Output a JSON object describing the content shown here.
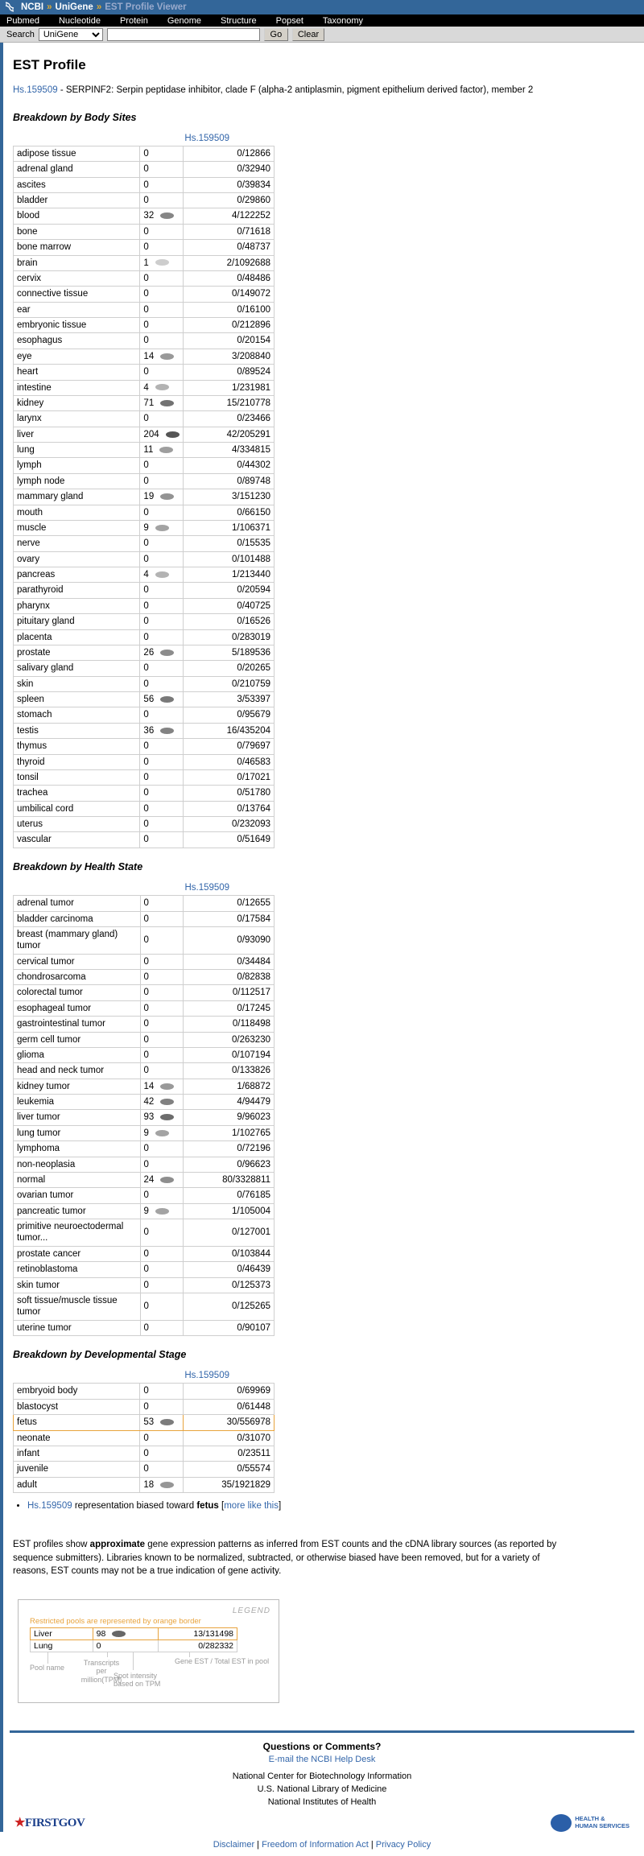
{
  "topbar": {
    "logo_icon": "ncbi-dna-logo",
    "crumb1": "NCBI",
    "sep": "»",
    "crumb2": "UniGene",
    "crumb3": "EST Profile Viewer"
  },
  "nav": {
    "items": [
      {
        "label": "Pubmed"
      },
      {
        "label": "Nucleotide"
      },
      {
        "label": "Protein"
      },
      {
        "label": "Genome"
      },
      {
        "label": "Structure"
      },
      {
        "label": "Popset"
      },
      {
        "label": "Taxonomy"
      }
    ]
  },
  "search": {
    "label": "Search",
    "database": "UniGene",
    "options": [
      "UniGene"
    ],
    "query": "",
    "placeholder": "",
    "go_label": "Go",
    "clear_label": "Clear"
  },
  "page": {
    "title": "EST Profile",
    "gene_id": "Hs.159509",
    "gene_desc": " - SERPINF2: Serpin peptidase inhibitor, clade F (alpha-2 antiplasmin, pigment epithelium derived factor), member 2"
  },
  "sections": [
    {
      "heading": "Breakdown by Body Sites",
      "column_header": "Hs.159509",
      "rows": [
        {
          "name": "adipose tissue",
          "tpm": "0",
          "frac": "0/12866",
          "dot": 0.0
        },
        {
          "name": "adrenal gland",
          "tpm": "0",
          "frac": "0/32940",
          "dot": 0.0
        },
        {
          "name": "ascites",
          "tpm": "0",
          "frac": "0/39834",
          "dot": 0.0
        },
        {
          "name": "bladder",
          "tpm": "0",
          "frac": "0/29860",
          "dot": 0.0
        },
        {
          "name": "blood",
          "tpm": "32",
          "frac": "4/122252",
          "dot": 0.62
        },
        {
          "name": "bone",
          "tpm": "0",
          "frac": "0/71618",
          "dot": 0.0
        },
        {
          "name": "bone marrow",
          "tpm": "0",
          "frac": "0/48737",
          "dot": 0.0
        },
        {
          "name": "brain",
          "tpm": "1",
          "frac": "2/1092688",
          "dot": 0.08
        },
        {
          "name": "cervix",
          "tpm": "0",
          "frac": "0/48486",
          "dot": 0.0
        },
        {
          "name": "connective tissue",
          "tpm": "0",
          "frac": "0/149072",
          "dot": 0.0
        },
        {
          "name": "ear",
          "tpm": "0",
          "frac": "0/16100",
          "dot": 0.0
        },
        {
          "name": "embryonic tissue",
          "tpm": "0",
          "frac": "0/212896",
          "dot": 0.0
        },
        {
          "name": "esophagus",
          "tpm": "0",
          "frac": "0/20154",
          "dot": 0.0
        },
        {
          "name": "eye",
          "tpm": "14",
          "frac": "3/208840",
          "dot": 0.48
        },
        {
          "name": "heart",
          "tpm": "0",
          "frac": "0/89524",
          "dot": 0.0
        },
        {
          "name": "intestine",
          "tpm": "4",
          "frac": "1/231981",
          "dot": 0.28
        },
        {
          "name": "kidney",
          "tpm": "71",
          "frac": "15/210778",
          "dot": 0.78
        },
        {
          "name": "larynx",
          "tpm": "0",
          "frac": "0/23466",
          "dot": 0.0
        },
        {
          "name": "liver",
          "tpm": "204",
          "frac": "42/205291",
          "dot": 1.0
        },
        {
          "name": "lung",
          "tpm": "11",
          "frac": "4/334815",
          "dot": 0.44
        },
        {
          "name": "lymph",
          "tpm": "0",
          "frac": "0/44302",
          "dot": 0.0
        },
        {
          "name": "lymph node",
          "tpm": "0",
          "frac": "0/89748",
          "dot": 0.0
        },
        {
          "name": "mammary gland",
          "tpm": "19",
          "frac": "3/151230",
          "dot": 0.52
        },
        {
          "name": "mouth",
          "tpm": "0",
          "frac": "0/66150",
          "dot": 0.0
        },
        {
          "name": "muscle",
          "tpm": "9",
          "frac": "1/106371",
          "dot": 0.4
        },
        {
          "name": "nerve",
          "tpm": "0",
          "frac": "0/15535",
          "dot": 0.0
        },
        {
          "name": "ovary",
          "tpm": "0",
          "frac": "0/101488",
          "dot": 0.0
        },
        {
          "name": "pancreas",
          "tpm": "4",
          "frac": "1/213440",
          "dot": 0.28
        },
        {
          "name": "parathyroid",
          "tpm": "0",
          "frac": "0/20594",
          "dot": 0.0
        },
        {
          "name": "pharynx",
          "tpm": "0",
          "frac": "0/40725",
          "dot": 0.0
        },
        {
          "name": "pituitary gland",
          "tpm": "0",
          "frac": "0/16526",
          "dot": 0.0
        },
        {
          "name": "placenta",
          "tpm": "0",
          "frac": "0/283019",
          "dot": 0.0
        },
        {
          "name": "prostate",
          "tpm": "26",
          "frac": "5/189536",
          "dot": 0.58
        },
        {
          "name": "salivary gland",
          "tpm": "0",
          "frac": "0/20265",
          "dot": 0.0
        },
        {
          "name": "skin",
          "tpm": "0",
          "frac": "0/210759",
          "dot": 0.0
        },
        {
          "name": "spleen",
          "tpm": "56",
          "frac": "3/53397",
          "dot": 0.72
        },
        {
          "name": "stomach",
          "tpm": "0",
          "frac": "0/95679",
          "dot": 0.0
        },
        {
          "name": "testis",
          "tpm": "36",
          "frac": "16/435204",
          "dot": 0.65
        },
        {
          "name": "thymus",
          "tpm": "0",
          "frac": "0/79697",
          "dot": 0.0
        },
        {
          "name": "thyroid",
          "tpm": "0",
          "frac": "0/46583",
          "dot": 0.0
        },
        {
          "name": "tonsil",
          "tpm": "0",
          "frac": "0/17021",
          "dot": 0.0
        },
        {
          "name": "trachea",
          "tpm": "0",
          "frac": "0/51780",
          "dot": 0.0
        },
        {
          "name": "umbilical cord",
          "tpm": "0",
          "frac": "0/13764",
          "dot": 0.0
        },
        {
          "name": "uterus",
          "tpm": "0",
          "frac": "0/232093",
          "dot": 0.0
        },
        {
          "name": "vascular",
          "tpm": "0",
          "frac": "0/51649",
          "dot": 0.0
        }
      ]
    },
    {
      "heading": "Breakdown by Health State",
      "column_header": "Hs.159509",
      "rows": [
        {
          "name": "adrenal tumor",
          "tpm": "0",
          "frac": "0/12655",
          "dot": 0.0
        },
        {
          "name": "bladder carcinoma",
          "tpm": "0",
          "frac": "0/17584",
          "dot": 0.0
        },
        {
          "name": "breast (mammary gland) tumor",
          "tpm": "0",
          "frac": "0/93090",
          "dot": 0.0
        },
        {
          "name": "cervical tumor",
          "tpm": "0",
          "frac": "0/34484",
          "dot": 0.0
        },
        {
          "name": "chondrosarcoma",
          "tpm": "0",
          "frac": "0/82838",
          "dot": 0.0
        },
        {
          "name": "colorectal tumor",
          "tpm": "0",
          "frac": "0/112517",
          "dot": 0.0
        },
        {
          "name": "esophageal tumor",
          "tpm": "0",
          "frac": "0/17245",
          "dot": 0.0
        },
        {
          "name": "gastrointestinal tumor",
          "tpm": "0",
          "frac": "0/118498",
          "dot": 0.0
        },
        {
          "name": "germ cell tumor",
          "tpm": "0",
          "frac": "0/263230",
          "dot": 0.0
        },
        {
          "name": "glioma",
          "tpm": "0",
          "frac": "0/107194",
          "dot": 0.0
        },
        {
          "name": "head and neck tumor",
          "tpm": "0",
          "frac": "0/133826",
          "dot": 0.0
        },
        {
          "name": "kidney tumor",
          "tpm": "14",
          "frac": "1/68872",
          "dot": 0.48
        },
        {
          "name": "leukemia",
          "tpm": "42",
          "frac": "4/94479",
          "dot": 0.66
        },
        {
          "name": "liver tumor",
          "tpm": "93",
          "frac": "9/96023",
          "dot": 0.82
        },
        {
          "name": "lung tumor",
          "tpm": "9",
          "frac": "1/102765",
          "dot": 0.4
        },
        {
          "name": "lymphoma",
          "tpm": "0",
          "frac": "0/72196",
          "dot": 0.0
        },
        {
          "name": "non-neoplasia",
          "tpm": "0",
          "frac": "0/96623",
          "dot": 0.0
        },
        {
          "name": "normal",
          "tpm": "24",
          "frac": "80/3328811",
          "dot": 0.56
        },
        {
          "name": "ovarian tumor",
          "tpm": "0",
          "frac": "0/76185",
          "dot": 0.0
        },
        {
          "name": "pancreatic tumor",
          "tpm": "9",
          "frac": "1/105004",
          "dot": 0.4
        },
        {
          "name": "primitive neuroectodermal tumor...",
          "tpm": "0",
          "frac": "0/127001",
          "dot": 0.0
        },
        {
          "name": "prostate cancer",
          "tpm": "0",
          "frac": "0/103844",
          "dot": 0.0
        },
        {
          "name": "retinoblastoma",
          "tpm": "0",
          "frac": "0/46439",
          "dot": 0.0
        },
        {
          "name": "skin tumor",
          "tpm": "0",
          "frac": "0/125373",
          "dot": 0.0
        },
        {
          "name": "soft tissue/muscle tissue tumor",
          "tpm": "0",
          "frac": "0/125265",
          "dot": 0.0
        },
        {
          "name": "uterine tumor",
          "tpm": "0",
          "frac": "0/90107",
          "dot": 0.0
        }
      ]
    },
    {
      "heading": "Breakdown by Developmental Stage",
      "column_header": "Hs.159509",
      "rows": [
        {
          "name": "embryoid body",
          "tpm": "0",
          "frac": "0/69969",
          "dot": 0.0
        },
        {
          "name": "blastocyst",
          "tpm": "0",
          "frac": "0/61448",
          "dot": 0.0
        },
        {
          "name": "fetus",
          "tpm": "53",
          "frac": "30/556978",
          "dot": 0.7,
          "highlight": true
        },
        {
          "name": "neonate",
          "tpm": "0",
          "frac": "0/31070",
          "dot": 0.0
        },
        {
          "name": "infant",
          "tpm": "0",
          "frac": "0/23511",
          "dot": 0.0
        },
        {
          "name": "juvenile",
          "tpm": "0",
          "frac": "0/55574",
          "dot": 0.0
        },
        {
          "name": "adult",
          "tpm": "18",
          "frac": "35/1921829",
          "dot": 0.5
        }
      ]
    }
  ],
  "bias_note": {
    "gene_link": "Hs.159509",
    "text_mid": " representation biased toward ",
    "bias_term": "fetus",
    "bracket_open": " [",
    "more_link": "more like this",
    "bracket_close": "]"
  },
  "blurb": {
    "p1": "EST profiles show ",
    "bold1": "approximate",
    "p2": " gene expression patterns as inferred from EST counts and the cDNA library sources (as reported by sequence submitters). Libraries known to be normalized, subtracted, or otherwise biased have been removed, but for a variety of reasons, EST counts may not be a true indication of gene activity."
  },
  "legend": {
    "title": "LEGEND",
    "restricted_note": "Restricted pools are represented by orange border",
    "rows": [
      {
        "name": "Liver",
        "tpm": "98",
        "frac": "13/131498",
        "dot": 0.86,
        "restricted": true
      },
      {
        "name": "Lung",
        "tpm": "0",
        "frac": "0/282332",
        "dot": 0.0,
        "restricted": false
      }
    ],
    "labels": {
      "pool_name": "Pool name",
      "transcripts": "Transcripts\nper million(TPM)",
      "spot": "Spot intensity\nbased on TPM",
      "gene_est": "Gene EST / Total EST in pool"
    }
  },
  "footer": {
    "questions": "Questions or Comments?",
    "email_link": "E-mail the NCBI Help Desk",
    "addr_line1": "National Center for Biotechnology Information",
    "addr_line2": "U.S. National Library of Medicine",
    "addr_line3": "National Institutes of Health",
    "firstgov_first": "FIRST",
    "firstgov_gov": "GOV",
    "hhs_line1": "HEALTH &",
    "hhs_line2": "HUMAN SERVICES",
    "links": [
      {
        "label": "Disclaimer"
      },
      {
        "label": "Freedom of Information Act"
      },
      {
        "label": "Privacy Policy"
      }
    ],
    "link_sep": "|"
  }
}
